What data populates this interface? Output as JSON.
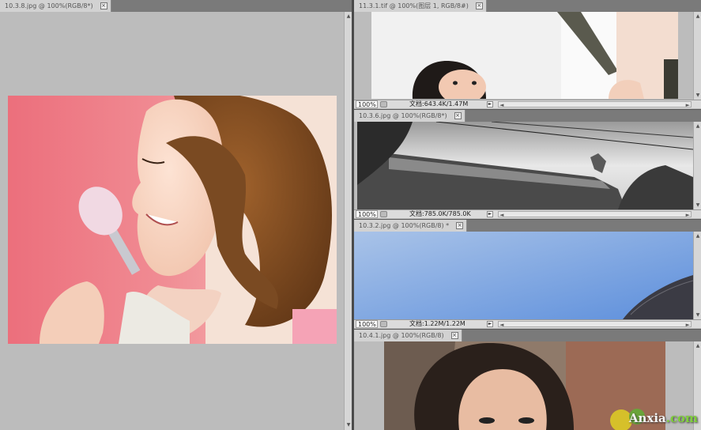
{
  "documents": [
    {
      "tab_title": "10.3.8.jpg @ 100%(RGB/8*)",
      "close_label": "×"
    },
    {
      "tab_title": "11.3.1.tif @ 100%(图层 1, RGB/8#)",
      "close_label": "×",
      "zoom": "100%",
      "doc_size": "文档:643.4K/1.47M"
    },
    {
      "tab_title": "10.3.6.jpg @ 100%(RGB/8*)",
      "close_label": "×",
      "zoom": "100%",
      "doc_size": "文档:785.0K/785.0K"
    },
    {
      "tab_title": "10.3.2.jpg @ 100%(RGB/8) *",
      "close_label": "×",
      "zoom": "100%",
      "doc_size": "文档:1.22M/1.22M"
    },
    {
      "tab_title": "10.4.1.jpg @ 100%(RGB/8)",
      "close_label": "×"
    }
  ],
  "scroll_glyphs": {
    "up": "▲",
    "down": "▼",
    "left": "◄",
    "right": "►",
    "menu": "►"
  },
  "watermark": {
    "text": "Anxia",
    "suffix": ".com"
  },
  "colors": {
    "workspace": "#bcbcbc",
    "tab_active": "#d2d2d2",
    "statusbar": "#dcdcdc"
  }
}
